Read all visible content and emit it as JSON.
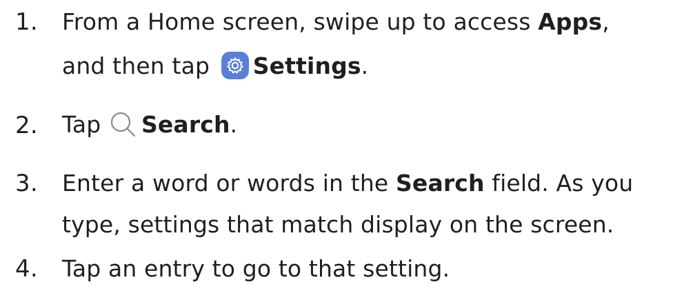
{
  "steps": [
    {
      "number": "1.",
      "line1_pre": "From a Home screen, swipe up to access ",
      "line1_bold": "Apps",
      "line1_post": ",",
      "line2_pre": "and then tap ",
      "line2_icon": "settings-gear-icon",
      "line2_bold": "Settings",
      "line2_post": "."
    },
    {
      "number": "2.",
      "pre": "Tap ",
      "icon": "search-icon",
      "bold": "Search",
      "post": "."
    },
    {
      "number": "3.",
      "line1_pre": "Enter a word or words in the ",
      "line1_bold": "Search",
      "line1_post": " field. As you",
      "line2": "type, settings that match display on the screen."
    },
    {
      "number": "4.",
      "text": "Tap an entry to go to that setting."
    }
  ],
  "colors": {
    "text": "#1f1f1f",
    "settings_icon_bg": "#5b7ed6",
    "search_icon": "#8a8a8a"
  }
}
